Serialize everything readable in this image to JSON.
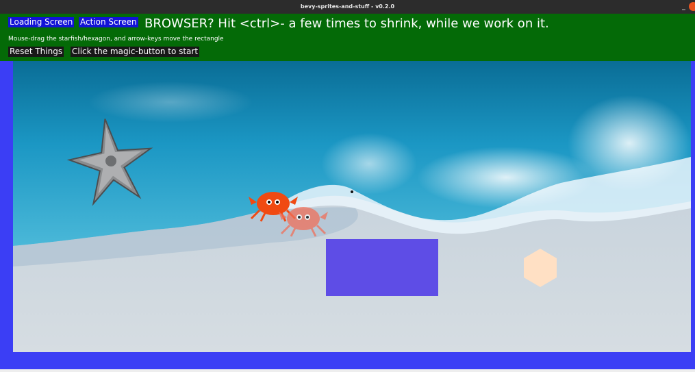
{
  "window": {
    "title": "bevy-sprites-and-stuff - v0.2.0",
    "minimize_glyph": "_"
  },
  "header": {
    "loading_screen_label": "Loading Screen",
    "action_screen_label": "Action Screen",
    "headline": "BROWSER? Hit <ctrl>- a few times to shrink, while we work on it.",
    "hint": "Mouse-drag the starfish/hexagon, and arrow-keys move the rectangle",
    "reset_label": "Reset Things",
    "magic_label": "Click the magic-button to start"
  },
  "colors": {
    "header_bg": "#046a07",
    "page_bg": "#3b3ef5",
    "tab_bg": "#1212d8",
    "button_bg": "#181818",
    "rectangle": "#5e4de6",
    "hexagon": "#ffe0c4",
    "crab": "#f04a12"
  }
}
